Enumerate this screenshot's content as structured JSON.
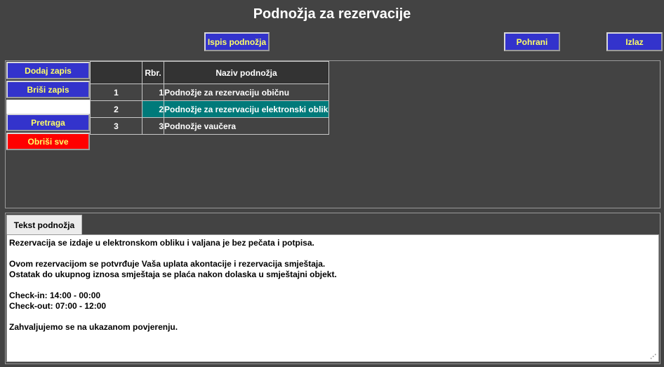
{
  "page": {
    "title": "Podnožja za rezervacije"
  },
  "toolbar": {
    "print_label": "Ispis podnožja",
    "save_label": "Pohrani",
    "exit_label": "Izlaz"
  },
  "side_buttons": {
    "add_label": "Dodaj zapis",
    "delete_label": "Briši zapis",
    "search_label": "Pretraga",
    "clear_all_label": "Obriši sve"
  },
  "grid": {
    "headers": {
      "index": "",
      "rbr": "Rbr.",
      "name": "Naziv podnožja"
    },
    "rows": [
      {
        "index": "1",
        "rbr": "1",
        "name": "Podnožje za rezervaciju običnu"
      },
      {
        "index": "2",
        "rbr": "2",
        "name": "Podnožje za rezervaciju elektronski oblik"
      },
      {
        "index": "3",
        "rbr": "3",
        "name": "Podnožje vaučera"
      }
    ],
    "selected_row": 2
  },
  "footer_text": {
    "tab_label": "Tekst podnožja",
    "content": "Rezervacija se izdaje u elektronskom obliku i valjana je bez pečata i potpisa.\n\nOvom rezervacijom se potvrđuje Vaša uplata akontacije i rezervacija smještaja.\nOstatak do ukupnog iznosa smještaja se plaća nakon dolaska u smještajni objekt.\n\nCheck-in: 14:00 - 00:00\nCheck-out: 07:00 - 12:00\n\nZahvaljujemo se na ukazanom povjerenju."
  },
  "colors": {
    "background": "#434343",
    "button_blue": "#3333cc",
    "button_text": "#ffff66",
    "button_red": "#ff0000",
    "selected_row": "#007a7a"
  }
}
